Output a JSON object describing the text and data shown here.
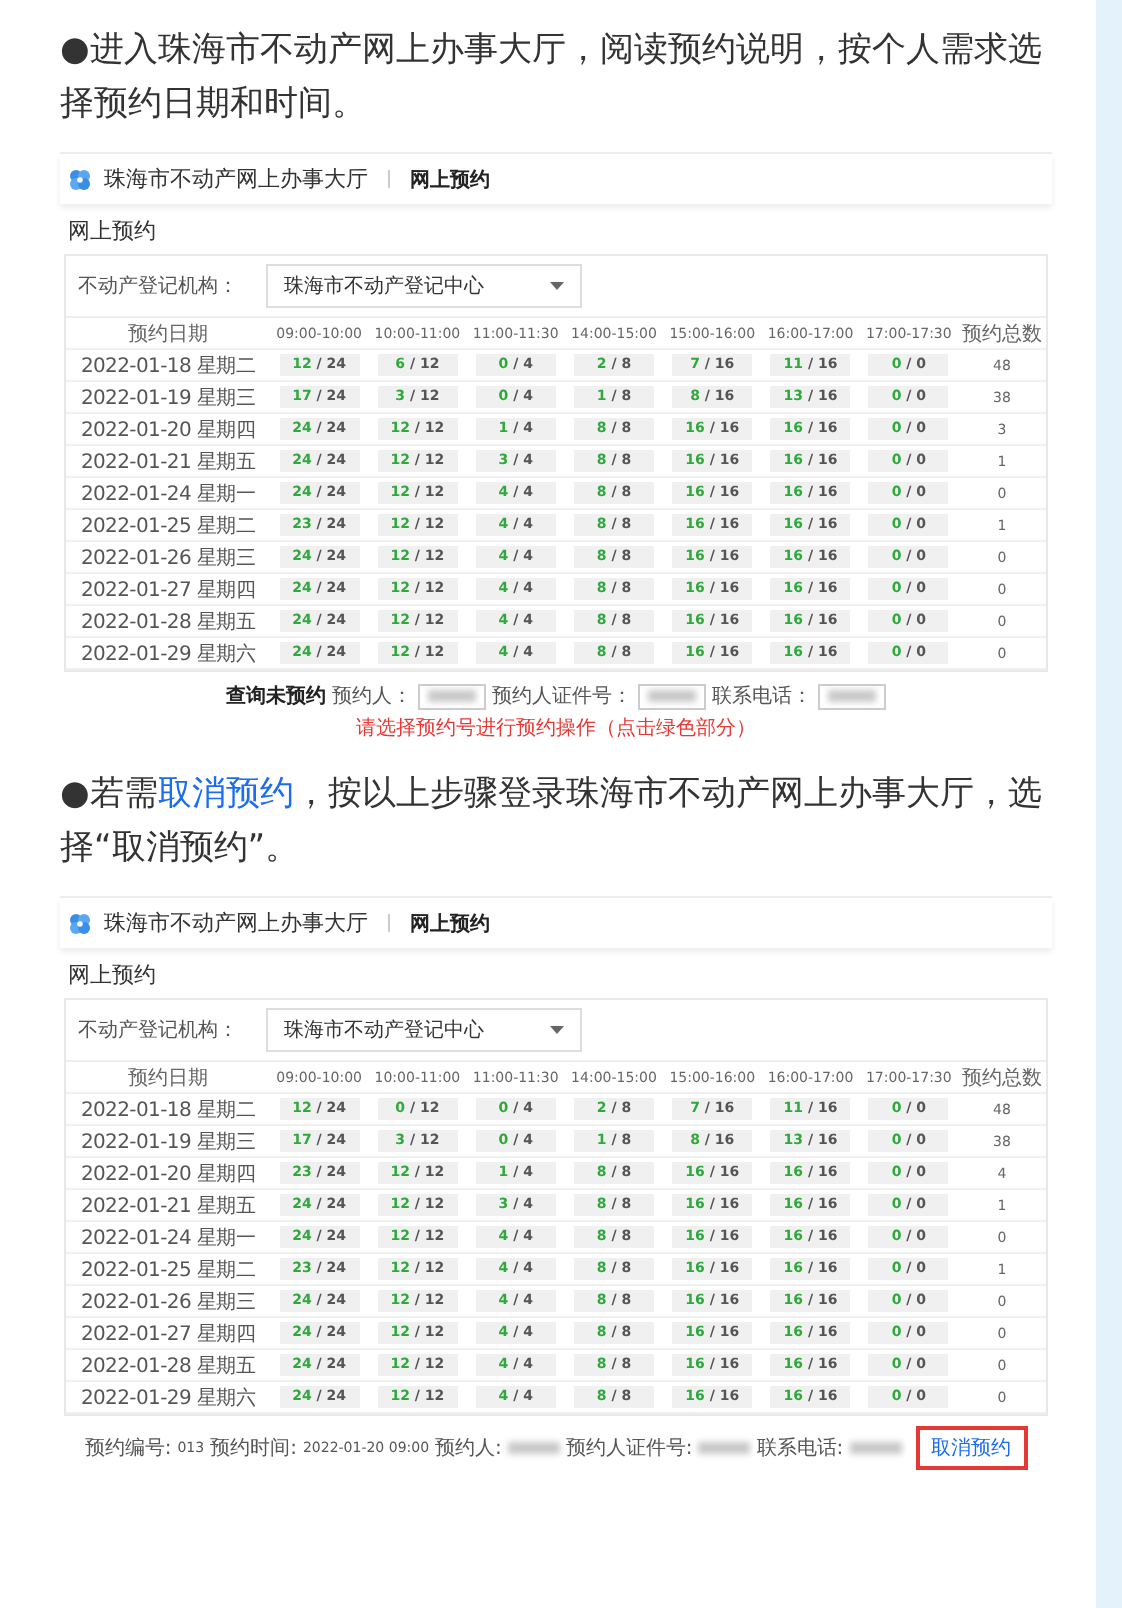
{
  "sections": [
    {
      "paragraph": [
        {
          "kind": "text",
          "text": "●进入珠海市不动产网上办事大厅，阅读预约说明，按个人需求选择预约日期和时间。"
        }
      ],
      "screenshot": {
        "site_title": "珠海市不动产网上办事大厅",
        "breadcrumb": "网上预约",
        "heading": "网上预约",
        "office_label": "不动产登记机构：",
        "office_value": "珠海市不动产登记中心",
        "separator": "/",
        "columns": [
          "预约日期",
          "09:00-10:00",
          "10:00-11:00",
          "11:00-11:30",
          "14:00-15:00",
          "15:00-16:00",
          "16:00-17:00",
          "17:00-17:30",
          "预约总数"
        ],
        "rows": [
          {
            "date": "2022-01-18 星期二",
            "slots": [
              [
                "12",
                "24"
              ],
              [
                "6",
                "12"
              ],
              [
                "0",
                "4"
              ],
              [
                "2",
                "8"
              ],
              [
                "7",
                "16"
              ],
              [
                "11",
                "16"
              ],
              [
                "0",
                "0"
              ]
            ],
            "total": "48"
          },
          {
            "date": "2022-01-19 星期三",
            "slots": [
              [
                "17",
                "24"
              ],
              [
                "3",
                "12"
              ],
              [
                "0",
                "4"
              ],
              [
                "1",
                "8"
              ],
              [
                "8",
                "16"
              ],
              [
                "13",
                "16"
              ],
              [
                "0",
                "0"
              ]
            ],
            "total": "38"
          },
          {
            "date": "2022-01-20 星期四",
            "slots": [
              [
                "24",
                "24"
              ],
              [
                "12",
                "12"
              ],
              [
                "1",
                "4"
              ],
              [
                "8",
                "8"
              ],
              [
                "16",
                "16"
              ],
              [
                "16",
                "16"
              ],
              [
                "0",
                "0"
              ]
            ],
            "total": "3"
          },
          {
            "date": "2022-01-21 星期五",
            "slots": [
              [
                "24",
                "24"
              ],
              [
                "12",
                "12"
              ],
              [
                "3",
                "4"
              ],
              [
                "8",
                "8"
              ],
              [
                "16",
                "16"
              ],
              [
                "16",
                "16"
              ],
              [
                "0",
                "0"
              ]
            ],
            "total": "1"
          },
          {
            "date": "2022-01-24 星期一",
            "slots": [
              [
                "24",
                "24"
              ],
              [
                "12",
                "12"
              ],
              [
                "4",
                "4"
              ],
              [
                "8",
                "8"
              ],
              [
                "16",
                "16"
              ],
              [
                "16",
                "16"
              ],
              [
                "0",
                "0"
              ]
            ],
            "total": "0"
          },
          {
            "date": "2022-01-25 星期二",
            "slots": [
              [
                "23",
                "24"
              ],
              [
                "12",
                "12"
              ],
              [
                "4",
                "4"
              ],
              [
                "8",
                "8"
              ],
              [
                "16",
                "16"
              ],
              [
                "16",
                "16"
              ],
              [
                "0",
                "0"
              ]
            ],
            "total": "1"
          },
          {
            "date": "2022-01-26 星期三",
            "slots": [
              [
                "24",
                "24"
              ],
              [
                "12",
                "12"
              ],
              [
                "4",
                "4"
              ],
              [
                "8",
                "8"
              ],
              [
                "16",
                "16"
              ],
              [
                "16",
                "16"
              ],
              [
                "0",
                "0"
              ]
            ],
            "total": "0"
          },
          {
            "date": "2022-01-27 星期四",
            "slots": [
              [
                "24",
                "24"
              ],
              [
                "12",
                "12"
              ],
              [
                "4",
                "4"
              ],
              [
                "8",
                "8"
              ],
              [
                "16",
                "16"
              ],
              [
                "16",
                "16"
              ],
              [
                "0",
                "0"
              ]
            ],
            "total": "0"
          },
          {
            "date": "2022-01-28 星期五",
            "slots": [
              [
                "24",
                "24"
              ],
              [
                "12",
                "12"
              ],
              [
                "4",
                "4"
              ],
              [
                "8",
                "8"
              ],
              [
                "16",
                "16"
              ],
              [
                "16",
                "16"
              ],
              [
                "0",
                "0"
              ]
            ],
            "total": "0"
          },
          {
            "date": "2022-01-29 星期六",
            "slots": [
              [
                "24",
                "24"
              ],
              [
                "12",
                "12"
              ],
              [
                "4",
                "4"
              ],
              [
                "8",
                "8"
              ],
              [
                "16",
                "16"
              ],
              [
                "16",
                "16"
              ],
              [
                "0",
                "0"
              ]
            ],
            "total": "0"
          }
        ],
        "footer": [
          {
            "kind": "strong",
            "text": "查询未预约"
          },
          {
            "kind": "label",
            "text": "预约人："
          },
          {
            "kind": "field"
          },
          {
            "kind": "label",
            "text": "预约人证件号："
          },
          {
            "kind": "field"
          },
          {
            "kind": "label",
            "text": "联系电话："
          },
          {
            "kind": "field"
          },
          {
            "kind": "hint",
            "text": "请选择预约号进行预约操作（点击绿色部分）"
          }
        ]
      }
    },
    {
      "paragraph": [
        {
          "kind": "text",
          "text": "●若需"
        },
        {
          "kind": "link",
          "text": "取消预约"
        },
        {
          "kind": "text",
          "text": "，按以上步骤登录珠海市不动产网上办事大厅，选择“取消预约”。"
        }
      ],
      "screenshot": {
        "site_title": "珠海市不动产网上办事大厅",
        "breadcrumb": "网上预约",
        "heading": "网上预约",
        "office_label": "不动产登记机构：",
        "office_value": "珠海市不动产登记中心",
        "separator": "/",
        "columns": [
          "预约日期",
          "09:00-10:00",
          "10:00-11:00",
          "11:00-11:30",
          "14:00-15:00",
          "15:00-16:00",
          "16:00-17:00",
          "17:00-17:30",
          "预约总数"
        ],
        "rows": [
          {
            "date": "2022-01-18 星期二",
            "slots": [
              [
                "12",
                "24"
              ],
              [
                "0",
                "12"
              ],
              [
                "0",
                "4"
              ],
              [
                "2",
                "8"
              ],
              [
                "7",
                "16"
              ],
              [
                "11",
                "16"
              ],
              [
                "0",
                "0"
              ]
            ],
            "total": "48"
          },
          {
            "date": "2022-01-19 星期三",
            "slots": [
              [
                "17",
                "24"
              ],
              [
                "3",
                "12"
              ],
              [
                "0",
                "4"
              ],
              [
                "1",
                "8"
              ],
              [
                "8",
                "16"
              ],
              [
                "13",
                "16"
              ],
              [
                "0",
                "0"
              ]
            ],
            "total": "38"
          },
          {
            "date": "2022-01-20 星期四",
            "slots": [
              [
                "23",
                "24"
              ],
              [
                "12",
                "12"
              ],
              [
                "1",
                "4"
              ],
              [
                "8",
                "8"
              ],
              [
                "16",
                "16"
              ],
              [
                "16",
                "16"
              ],
              [
                "0",
                "0"
              ]
            ],
            "total": "4"
          },
          {
            "date": "2022-01-21 星期五",
            "slots": [
              [
                "24",
                "24"
              ],
              [
                "12",
                "12"
              ],
              [
                "3",
                "4"
              ],
              [
                "8",
                "8"
              ],
              [
                "16",
                "16"
              ],
              [
                "16",
                "16"
              ],
              [
                "0",
                "0"
              ]
            ],
            "total": "1"
          },
          {
            "date": "2022-01-24 星期一",
            "slots": [
              [
                "24",
                "24"
              ],
              [
                "12",
                "12"
              ],
              [
                "4",
                "4"
              ],
              [
                "8",
                "8"
              ],
              [
                "16",
                "16"
              ],
              [
                "16",
                "16"
              ],
              [
                "0",
                "0"
              ]
            ],
            "total": "0"
          },
          {
            "date": "2022-01-25 星期二",
            "slots": [
              [
                "23",
                "24"
              ],
              [
                "12",
                "12"
              ],
              [
                "4",
                "4"
              ],
              [
                "8",
                "8"
              ],
              [
                "16",
                "16"
              ],
              [
                "16",
                "16"
              ],
              [
                "0",
                "0"
              ]
            ],
            "total": "1"
          },
          {
            "date": "2022-01-26 星期三",
            "slots": [
              [
                "24",
                "24"
              ],
              [
                "12",
                "12"
              ],
              [
                "4",
                "4"
              ],
              [
                "8",
                "8"
              ],
              [
                "16",
                "16"
              ],
              [
                "16",
                "16"
              ],
              [
                "0",
                "0"
              ]
            ],
            "total": "0"
          },
          {
            "date": "2022-01-27 星期四",
            "slots": [
              [
                "24",
                "24"
              ],
              [
                "12",
                "12"
              ],
              [
                "4",
                "4"
              ],
              [
                "8",
                "8"
              ],
              [
                "16",
                "16"
              ],
              [
                "16",
                "16"
              ],
              [
                "0",
                "0"
              ]
            ],
            "total": "0"
          },
          {
            "date": "2022-01-28 星期五",
            "slots": [
              [
                "24",
                "24"
              ],
              [
                "12",
                "12"
              ],
              [
                "4",
                "4"
              ],
              [
                "8",
                "8"
              ],
              [
                "16",
                "16"
              ],
              [
                "16",
                "16"
              ],
              [
                "0",
                "0"
              ]
            ],
            "total": "0"
          },
          {
            "date": "2022-01-29 星期六",
            "slots": [
              [
                "24",
                "24"
              ],
              [
                "12",
                "12"
              ],
              [
                "4",
                "4"
              ],
              [
                "8",
                "8"
              ],
              [
                "16",
                "16"
              ],
              [
                "16",
                "16"
              ],
              [
                "0",
                "0"
              ]
            ],
            "total": "0"
          }
        ],
        "footer": [
          {
            "kind": "label",
            "text": "预约编号:"
          },
          {
            "kind": "value",
            "text": "013"
          },
          {
            "kind": "label",
            "text": "预约时间:"
          },
          {
            "kind": "value",
            "text": "2022-01-20 09:00"
          },
          {
            "kind": "label",
            "text": "预约人:"
          },
          {
            "kind": "redacted"
          },
          {
            "kind": "label",
            "text": "预约人证件号:"
          },
          {
            "kind": "redacted"
          },
          {
            "kind": "label",
            "text": "联系电话:"
          },
          {
            "kind": "redacted"
          },
          {
            "kind": "action",
            "text": "取消预约"
          }
        ]
      }
    }
  ]
}
